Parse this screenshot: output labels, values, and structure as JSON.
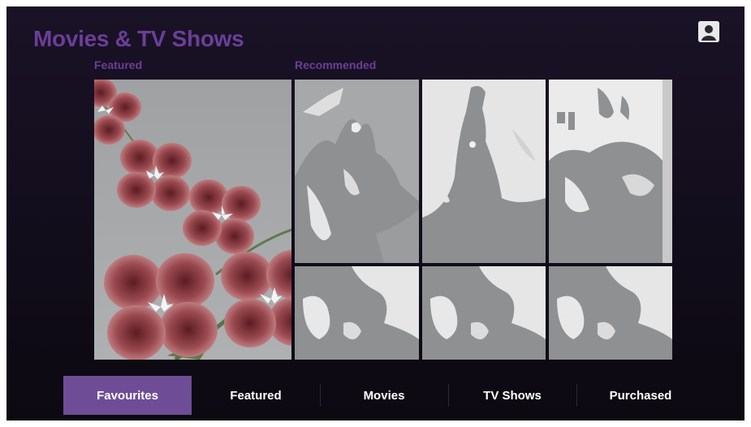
{
  "header": {
    "title": "Movies & TV Shows"
  },
  "sections": {
    "featured_label": "Featured",
    "recommended_label": "Recommended"
  },
  "profile": {
    "icon": "user-profile-icon"
  },
  "tabs": [
    {
      "label": "Favourites",
      "active": true
    },
    {
      "label": "Featured",
      "active": false
    },
    {
      "label": "Movies",
      "active": false
    },
    {
      "label": "TV Shows",
      "active": false
    },
    {
      "label": "Purchased",
      "active": false
    }
  ],
  "colors": {
    "accent": "#6a3f98",
    "active_tab": "#6e4d96",
    "background": "#130e1c"
  }
}
